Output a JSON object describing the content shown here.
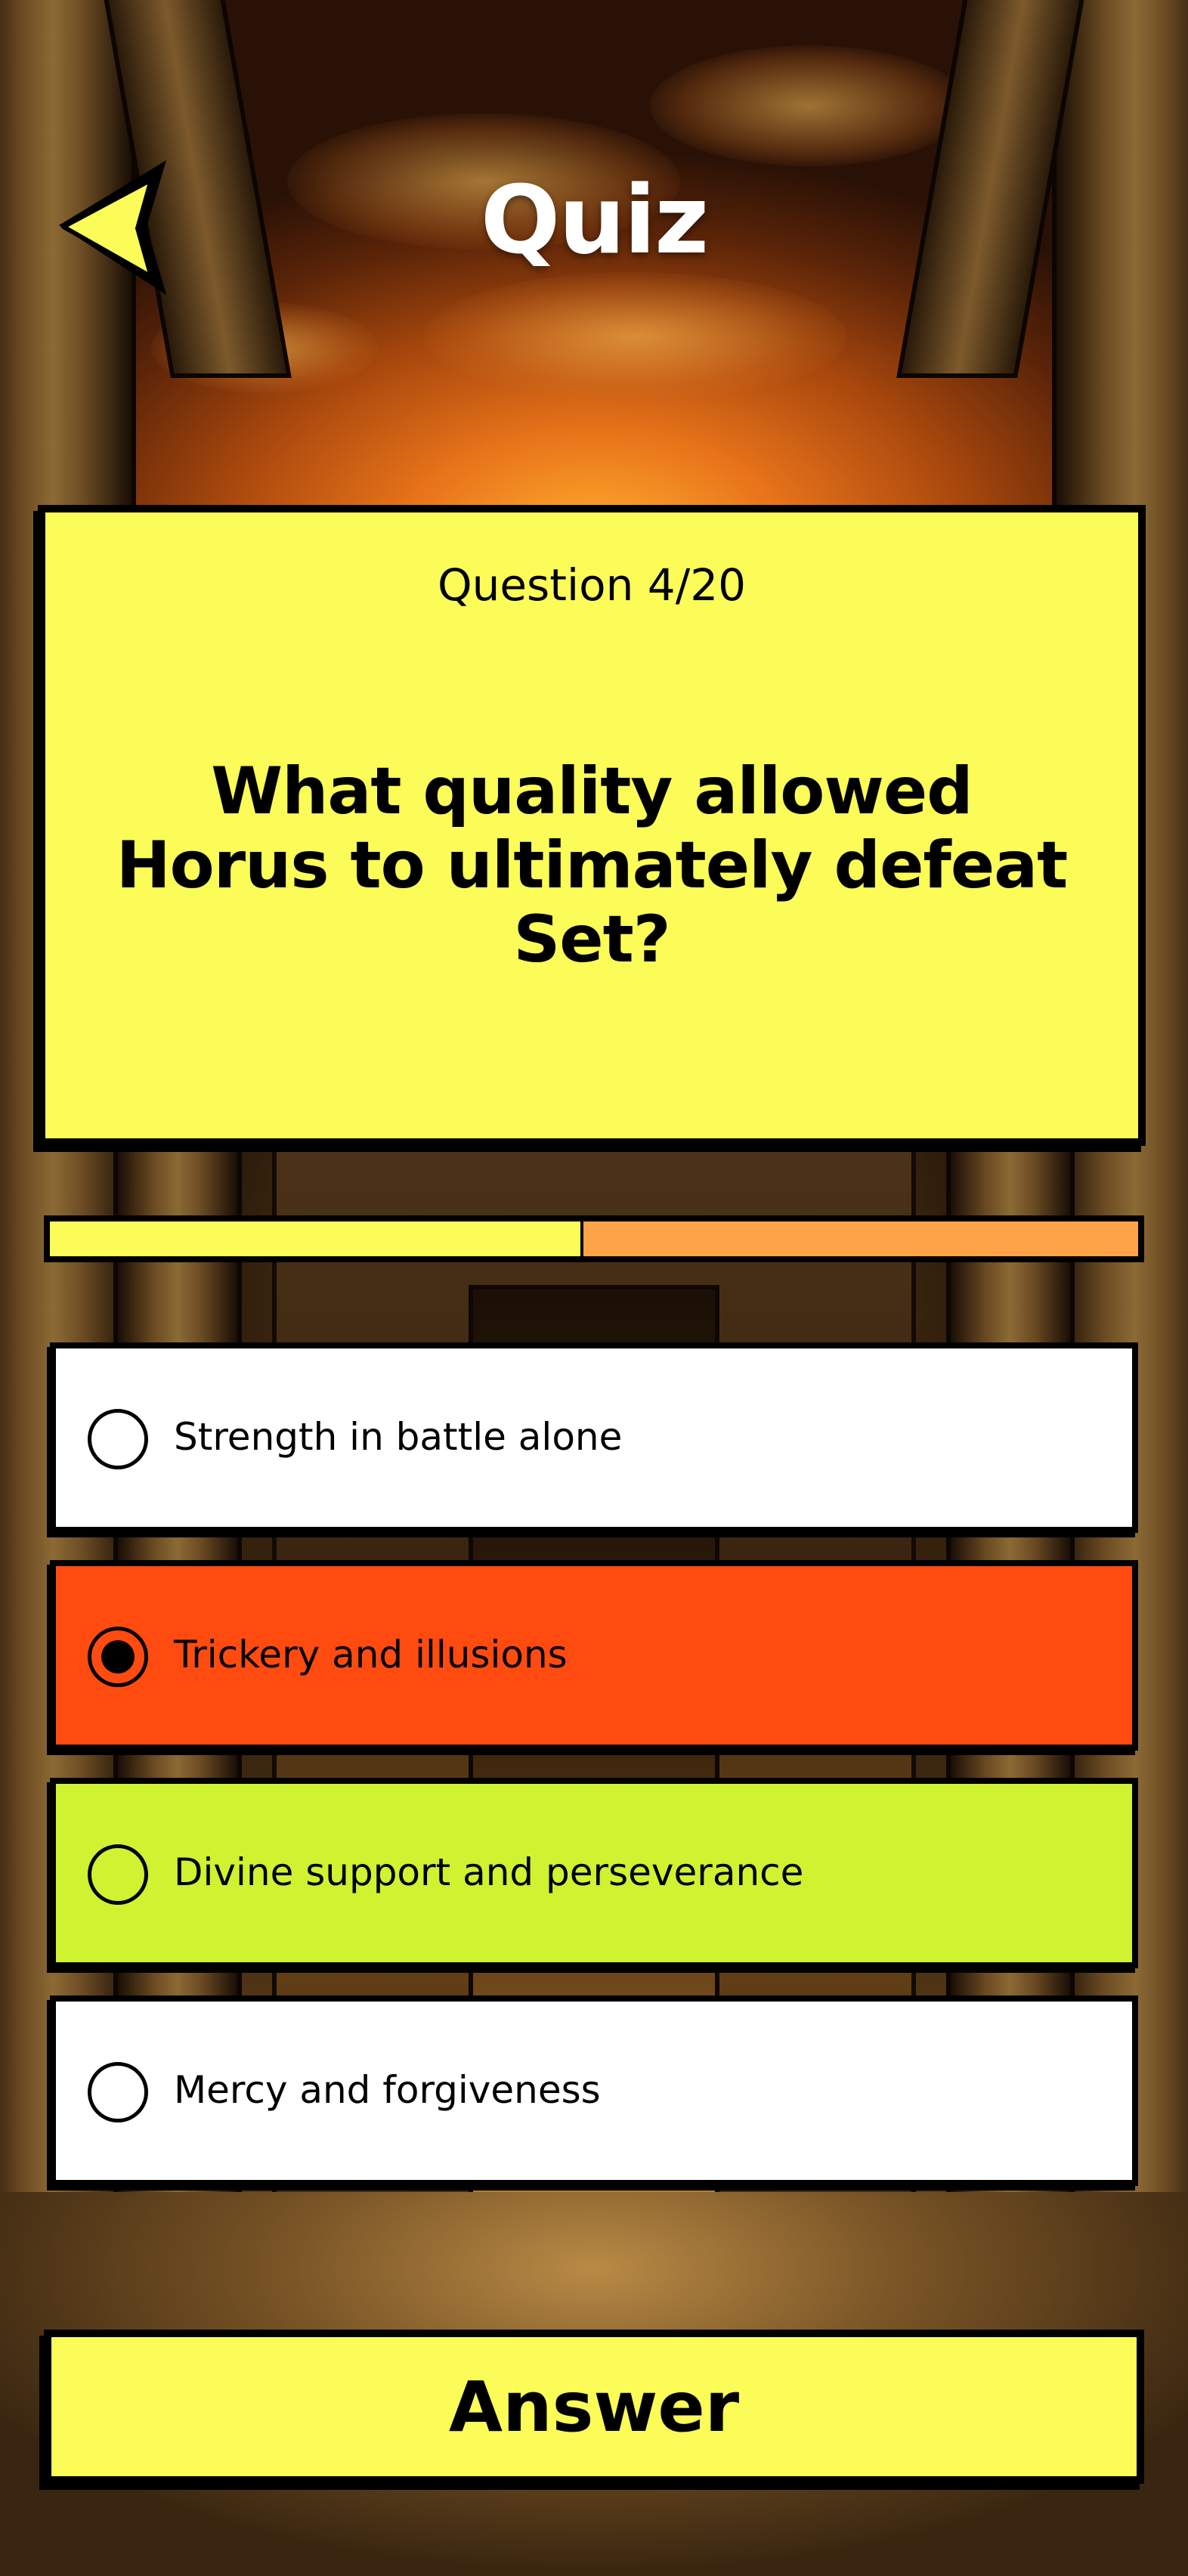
{
  "header": {
    "title": "Quiz",
    "back_icon": "back-arrow-icon"
  },
  "question": {
    "counter": "Question 4/20",
    "text": "What quality allowed Horus to ultimately defeat Set?"
  },
  "progress": {
    "value": 0.49
  },
  "options": [
    {
      "label": "Strength in battle alone",
      "state": "default",
      "background": "#ffffff"
    },
    {
      "label": "Trickery and illusions",
      "state": "selected",
      "background": "#ff4b0f"
    },
    {
      "label": "Divine support and perseverance",
      "state": "correct",
      "background": "#cff231"
    },
    {
      "label": "Mercy and forgiveness",
      "state": "default",
      "background": "#ffffff"
    }
  ],
  "answer_button": {
    "label": "Answer"
  },
  "colors": {
    "card": "#fbfc58",
    "progress_track": "#ffa348",
    "back_arrow": "#fbfc58"
  }
}
